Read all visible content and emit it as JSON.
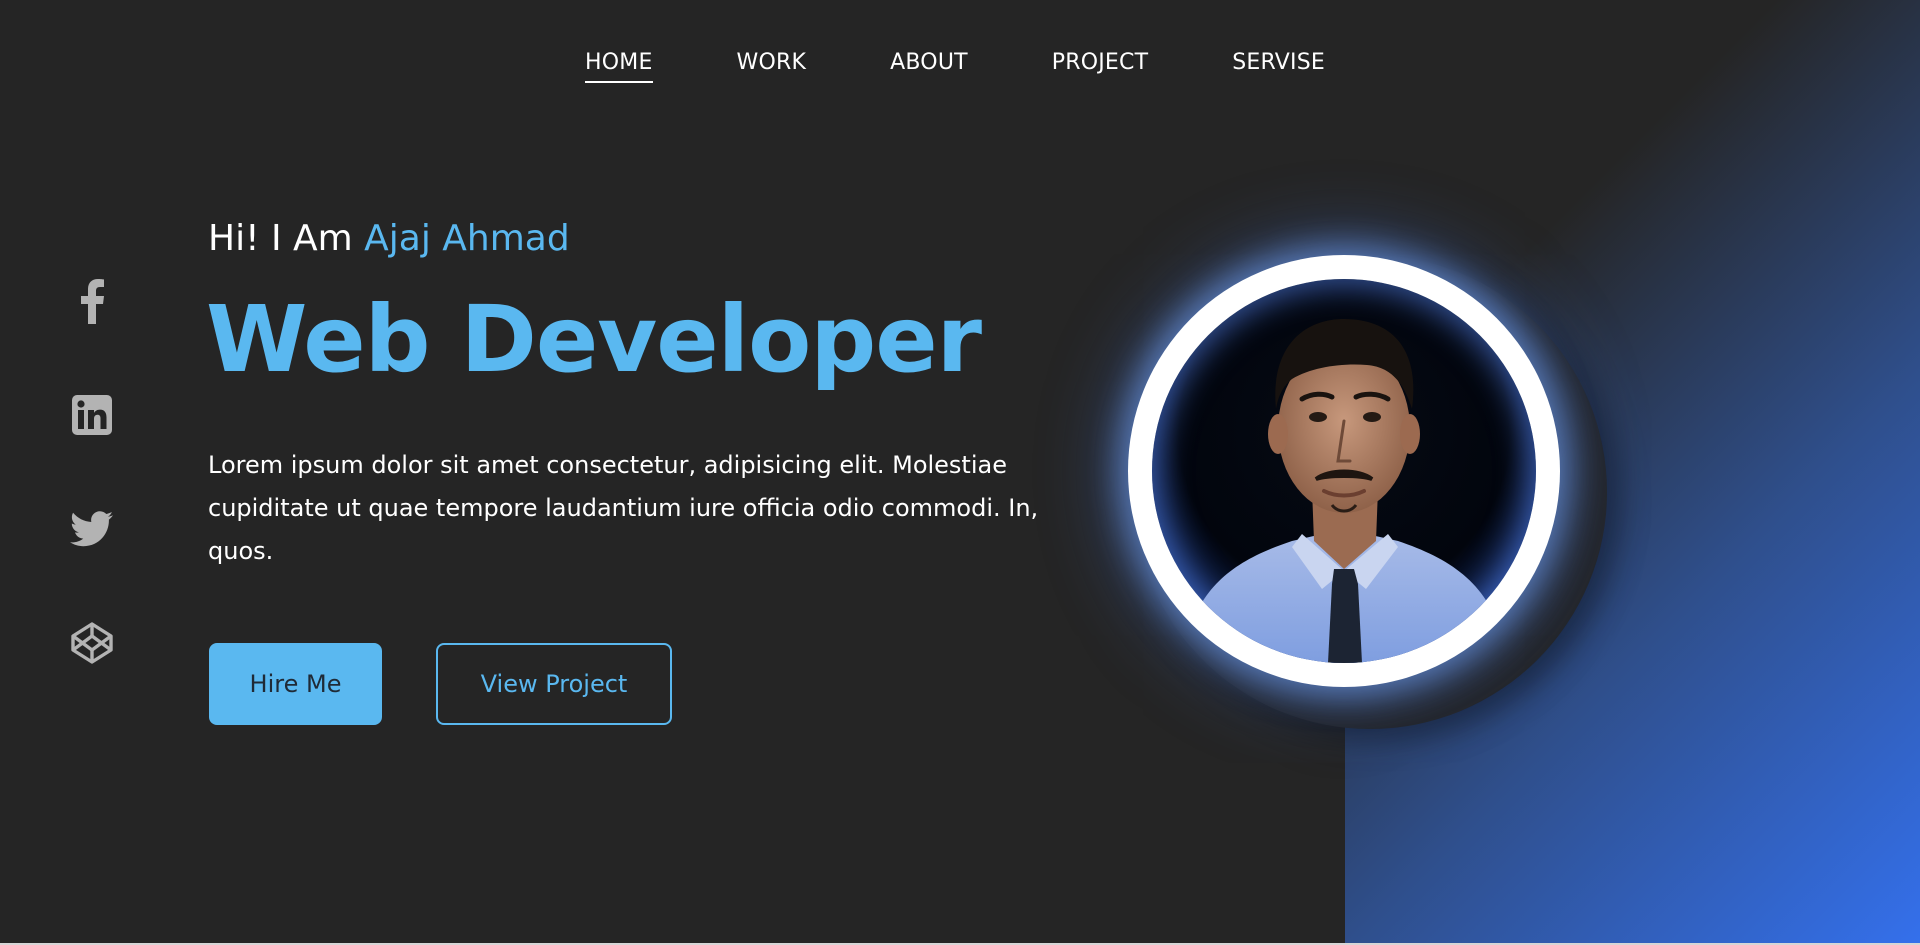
{
  "nav": {
    "items": [
      {
        "label": "HOME",
        "active": true
      },
      {
        "label": "WORK",
        "active": false
      },
      {
        "label": "ABOUT",
        "active": false
      },
      {
        "label": "PROJECT",
        "active": false
      },
      {
        "label": "SERVISE",
        "active": false
      }
    ]
  },
  "social": {
    "icons": [
      "facebook-icon",
      "linkedin-icon",
      "twitter-icon",
      "codepen-icon"
    ]
  },
  "hero": {
    "greeting": "Hi! I Am ",
    "name": "Ajaj Ahmad",
    "title": "Web Developer",
    "description": "Lorem ipsum dolor sit amet consectetur, adipisicing elit. Molestiae cupiditate ut quae tempore laudantium iure officia odio commodi. In, quos.",
    "hire_label": "Hire Me",
    "view_label": "View Project"
  },
  "colors": {
    "accent": "#5ab8f0",
    "background": "#252525",
    "gradient_end": "#3470ec",
    "text": "#ffffff"
  }
}
